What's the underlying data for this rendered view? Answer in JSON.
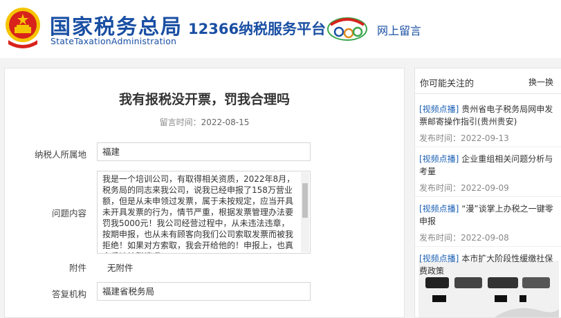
{
  "header": {
    "brand_cn": "国家税务总局",
    "brand_en": "StateTaxationAdministration",
    "platform": "12366纳税服务平台",
    "nav_link": "网上留言"
  },
  "main": {
    "title": "我有报税没开票，罚我合理吗",
    "date_label": "留言时间：",
    "date_value": "2022-08-15",
    "fields": {
      "location_label": "纳税人所属地",
      "location_value": "福建",
      "question_label": "问题内容",
      "question_value": "我是一个培训公司，有取得相关资质，2022年8月，税务局的同志来我公司，说我已经申报了158万营业额，但是从未申领过发票，属于未按规定，应当开具未开具发票的行为，情节严重，根据发票管理办法要罚我5000元！我公司经营过程中，从未违法违章，按期申报，也从未有顾客向我们公司索取发票而被我拒绝！如果对方索取，我会开给他的！申报上，也真实反映纳税情况！",
      "attachment_label": "附件",
      "attachment_value": "无附件",
      "agency_label": "答复机构",
      "agency_value": "福建省税务局"
    }
  },
  "sidebar": {
    "title": "你可能关注的",
    "refresh": "换一换",
    "items": [
      {
        "tag": "[视频点播]",
        "title": "贵州省电子税务局网申发票邮寄操作指引(贵州贵安)",
        "date_label": "发布时间：",
        "date": "2022-09-13"
      },
      {
        "tag": "[视频点播]",
        "title": "企业重组相关问题分析与考量",
        "date_label": "发布时间：",
        "date": "2022-09-09"
      },
      {
        "tag": "[视频点播]",
        "title": "“漫”谈掌上办税之一键零申报",
        "date_label": "发布时间：",
        "date": "2022-09-08"
      },
      {
        "tag": "[视频点播]",
        "title": "本市扩大阶段性缓缴社保费政策"
      }
    ]
  },
  "colors": {
    "brand_blue": "#1a4fa3",
    "tag_blue": "#1a5fb4",
    "emblem_red": "#d7231c",
    "emblem_gold": "#f5c400"
  },
  "icons": {
    "emblem": "national-emblem-icon",
    "badge": "tax-badge-icon"
  }
}
